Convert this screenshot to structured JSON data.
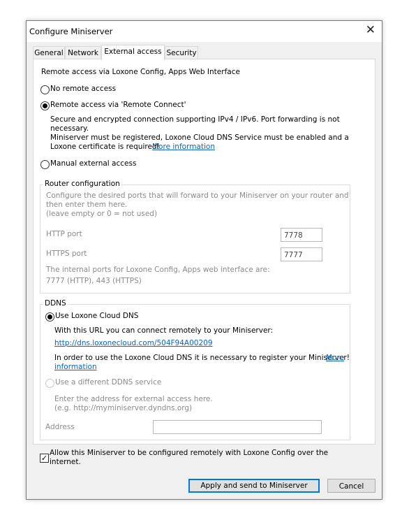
{
  "window": {
    "title": "Configure Miniserver"
  },
  "tabs": [
    {
      "label": "General"
    },
    {
      "label": "Network"
    },
    {
      "label": "External access"
    },
    {
      "label": "Security"
    }
  ],
  "header": "Remote access via Loxone Config, Apps  Web Interface",
  "options": {
    "no_remote": "No remote access",
    "remote_connect": "Remote access via 'Remote Connect'",
    "remote_connect_desc1": "Secure and encrypted connection supporting IPv4 / IPv6. Port forwarding is not",
    "remote_connect_desc2": "necessary.",
    "remote_connect_desc3": "Miniserver must be registered, Loxone Cloud DNS Service must be enabled and a",
    "remote_connect_desc4": "Loxone certificate is required!",
    "remote_connect_more": "More information",
    "manual": "Manual external access"
  },
  "router": {
    "legend": "Router configuration",
    "desc1": "Configure the desired ports that will forward to your Miniserver on your router and",
    "desc2": "then enter them here.",
    "desc3": "(leave empty or 0 = not used)",
    "http_label": "HTTP port",
    "http_value": "7778",
    "https_label": "HTTPS port",
    "https_value": "7777",
    "internal1": "The internal ports for Loxone Config, Apps  web interface are:",
    "internal2": "7777 (HTTP), 443 (HTTPS)"
  },
  "ddns": {
    "legend": "DDNS",
    "cloud": "Use Loxone Cloud DNS",
    "cloud_desc": "With this URL you can connect remotely to your Miniserver:",
    "cloud_url": "http://dns.loxonecloud.com/504F94A00209",
    "register1": "In order to use the Loxone Cloud DNS it is necessary to register your Miniserver!",
    "register_more1": "More",
    "register_more2": "information",
    "other": "Use a different DDNS service",
    "other_desc1": "Enter the address for external access here.",
    "other_desc2": "(e.g. http://myminiserver.dyndns.org)",
    "address_label": "Address",
    "address_value": ""
  },
  "allow": {
    "line1": "Allow this Miniserver to be configured remotely with Loxone Config over the",
    "line2": "internet.",
    "checked_mark": "✓"
  },
  "buttons": {
    "apply": "Apply and send to Miniserver",
    "cancel": "Cancel"
  },
  "icons": {
    "close": "✕"
  }
}
